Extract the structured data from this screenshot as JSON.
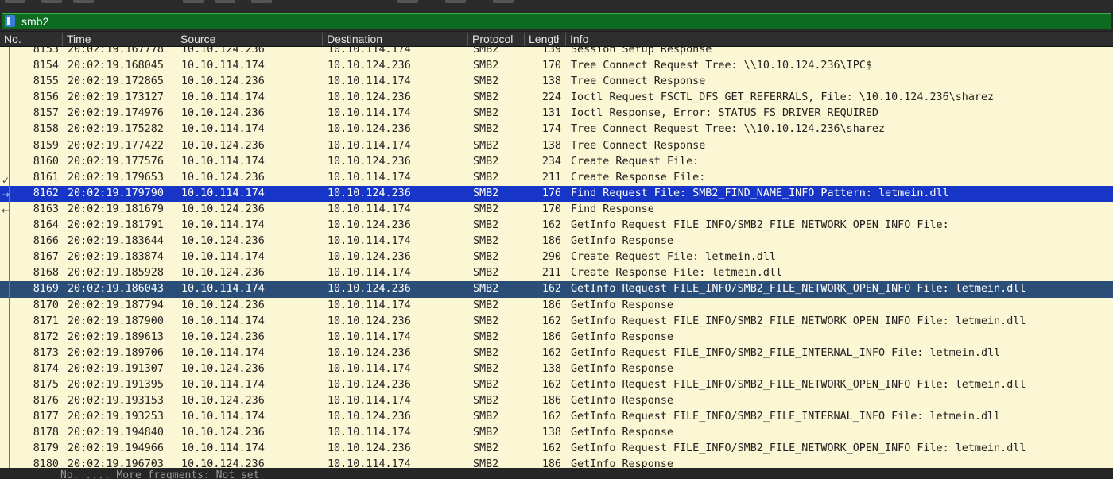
{
  "filter": {
    "text": "smb2"
  },
  "columns": {
    "no": "No.",
    "time": "Time",
    "source": "Source",
    "destination": "Destination",
    "protocol": "Protocol",
    "length": "Lengtł",
    "info": "Info"
  },
  "rows": [
    {
      "no": "8153",
      "time": "20:02:19.167778",
      "src": "10.10.124.236",
      "dst": "10.10.114.174",
      "proto": "SMB2",
      "len": "139",
      "info": "Session Setup Response",
      "style": ""
    },
    {
      "no": "8154",
      "time": "20:02:19.168045",
      "src": "10.10.114.174",
      "dst": "10.10.124.236",
      "proto": "SMB2",
      "len": "170",
      "info": "Tree Connect Request Tree: \\\\10.10.124.236\\IPC$",
      "style": ""
    },
    {
      "no": "8155",
      "time": "20:02:19.172865",
      "src": "10.10.124.236",
      "dst": "10.10.114.174",
      "proto": "SMB2",
      "len": "138",
      "info": "Tree Connect Response",
      "style": ""
    },
    {
      "no": "8156",
      "time": "20:02:19.173127",
      "src": "10.10.114.174",
      "dst": "10.10.124.236",
      "proto": "SMB2",
      "len": "224",
      "info": "Ioctl Request FSCTL_DFS_GET_REFERRALS, File: \\10.10.124.236\\sharez",
      "style": ""
    },
    {
      "no": "8157",
      "time": "20:02:19.174976",
      "src": "10.10.124.236",
      "dst": "10.10.114.174",
      "proto": "SMB2",
      "len": "131",
      "info": "Ioctl Response, Error: STATUS_FS_DRIVER_REQUIRED",
      "style": ""
    },
    {
      "no": "8158",
      "time": "20:02:19.175282",
      "src": "10.10.114.174",
      "dst": "10.10.124.236",
      "proto": "SMB2",
      "len": "174",
      "info": "Tree Connect Request Tree: \\\\10.10.124.236\\sharez",
      "style": ""
    },
    {
      "no": "8159",
      "time": "20:02:19.177422",
      "src": "10.10.124.236",
      "dst": "10.10.114.174",
      "proto": "SMB2",
      "len": "138",
      "info": "Tree Connect Response",
      "style": ""
    },
    {
      "no": "8160",
      "time": "20:02:19.177576",
      "src": "10.10.114.174",
      "dst": "10.10.124.236",
      "proto": "SMB2",
      "len": "234",
      "info": "Create Request File:",
      "style": ""
    },
    {
      "no": "8161",
      "time": "20:02:19.179653",
      "src": "10.10.124.236",
      "dst": "10.10.114.174",
      "proto": "SMB2",
      "len": "211",
      "info": "Create Response File:",
      "style": ""
    },
    {
      "no": "8162",
      "time": "20:02:19.179790",
      "src": "10.10.114.174",
      "dst": "10.10.124.236",
      "proto": "SMB2",
      "len": "176",
      "info": "Find Request File:  SMB2_FIND_NAME_INFO Pattern: letmein.dll",
      "style": "sel-blue"
    },
    {
      "no": "8163",
      "time": "20:02:19.181679",
      "src": "10.10.124.236",
      "dst": "10.10.114.174",
      "proto": "SMB2",
      "len": "170",
      "info": "Find Response",
      "style": ""
    },
    {
      "no": "8164",
      "time": "20:02:19.181791",
      "src": "10.10.114.174",
      "dst": "10.10.124.236",
      "proto": "SMB2",
      "len": "162",
      "info": "GetInfo Request FILE_INFO/SMB2_FILE_NETWORK_OPEN_INFO File:",
      "style": ""
    },
    {
      "no": "8166",
      "time": "20:02:19.183644",
      "src": "10.10.124.236",
      "dst": "10.10.114.174",
      "proto": "SMB2",
      "len": "186",
      "info": "GetInfo Response",
      "style": ""
    },
    {
      "no": "8167",
      "time": "20:02:19.183874",
      "src": "10.10.114.174",
      "dst": "10.10.124.236",
      "proto": "SMB2",
      "len": "290",
      "info": "Create Request File: letmein.dll",
      "style": ""
    },
    {
      "no": "8168",
      "time": "20:02:19.185928",
      "src": "10.10.124.236",
      "dst": "10.10.114.174",
      "proto": "SMB2",
      "len": "211",
      "info": "Create Response File: letmein.dll",
      "style": ""
    },
    {
      "no": "8169",
      "time": "20:02:19.186043",
      "src": "10.10.114.174",
      "dst": "10.10.124.236",
      "proto": "SMB2",
      "len": "162",
      "info": "GetInfo Request FILE_INFO/SMB2_FILE_NETWORK_OPEN_INFO File: letmein.dll",
      "style": "sel-dark"
    },
    {
      "no": "8170",
      "time": "20:02:19.187794",
      "src": "10.10.124.236",
      "dst": "10.10.114.174",
      "proto": "SMB2",
      "len": "186",
      "info": "GetInfo Response",
      "style": ""
    },
    {
      "no": "8171",
      "time": "20:02:19.187900",
      "src": "10.10.114.174",
      "dst": "10.10.124.236",
      "proto": "SMB2",
      "len": "162",
      "info": "GetInfo Request FILE_INFO/SMB2_FILE_NETWORK_OPEN_INFO File: letmein.dll",
      "style": ""
    },
    {
      "no": "8172",
      "time": "20:02:19.189613",
      "src": "10.10.124.236",
      "dst": "10.10.114.174",
      "proto": "SMB2",
      "len": "186",
      "info": "GetInfo Response",
      "style": ""
    },
    {
      "no": "8173",
      "time": "20:02:19.189706",
      "src": "10.10.114.174",
      "dst": "10.10.124.236",
      "proto": "SMB2",
      "len": "162",
      "info": "GetInfo Request FILE_INFO/SMB2_FILE_INTERNAL_INFO File: letmein.dll",
      "style": ""
    },
    {
      "no": "8174",
      "time": "20:02:19.191307",
      "src": "10.10.124.236",
      "dst": "10.10.114.174",
      "proto": "SMB2",
      "len": "138",
      "info": "GetInfo Response",
      "style": ""
    },
    {
      "no": "8175",
      "time": "20:02:19.191395",
      "src": "10.10.114.174",
      "dst": "10.10.124.236",
      "proto": "SMB2",
      "len": "162",
      "info": "GetInfo Request FILE_INFO/SMB2_FILE_NETWORK_OPEN_INFO File: letmein.dll",
      "style": ""
    },
    {
      "no": "8176",
      "time": "20:02:19.193153",
      "src": "10.10.124.236",
      "dst": "10.10.114.174",
      "proto": "SMB2",
      "len": "186",
      "info": "GetInfo Response",
      "style": ""
    },
    {
      "no": "8177",
      "time": "20:02:19.193253",
      "src": "10.10.114.174",
      "dst": "10.10.124.236",
      "proto": "SMB2",
      "len": "162",
      "info": "GetInfo Request FILE_INFO/SMB2_FILE_INTERNAL_INFO File: letmein.dll",
      "style": ""
    },
    {
      "no": "8178",
      "time": "20:02:19.194840",
      "src": "10.10.124.236",
      "dst": "10.10.114.174",
      "proto": "SMB2",
      "len": "138",
      "info": "GetInfo Response",
      "style": ""
    },
    {
      "no": "8179",
      "time": "20:02:19.194966",
      "src": "10.10.114.174",
      "dst": "10.10.124.236",
      "proto": "SMB2",
      "len": "162",
      "info": "GetInfo Request FILE_INFO/SMB2_FILE_NETWORK_OPEN_INFO File: letmein.dll",
      "style": ""
    },
    {
      "no": "8180",
      "time": "20:02:19.196703",
      "src": "10.10.124.236",
      "dst": "10.10.114.174",
      "proto": "SMB2",
      "len": "186",
      "info": "GetInfo Response",
      "style": ""
    }
  ],
  "bottom": {
    "detail_text": "No. ....   More fragments: Not set"
  }
}
